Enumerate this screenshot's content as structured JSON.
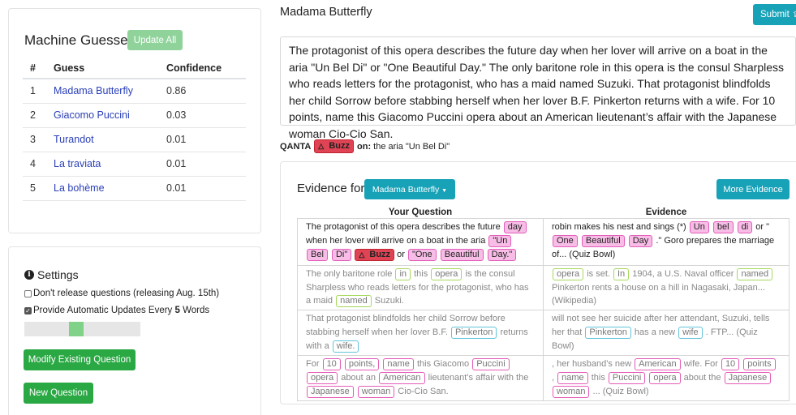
{
  "guesses": {
    "title": "Machine Guesses",
    "update_label": "Update All",
    "headers": [
      "#",
      "Guess",
      "Confidence"
    ],
    "rows": [
      {
        "num": "1",
        "guess": "Madama Butterfly",
        "conf": "0.86"
      },
      {
        "num": "2",
        "guess": "Giacomo Puccini",
        "conf": "0.03"
      },
      {
        "num": "3",
        "guess": "Turandot",
        "conf": "0.01"
      },
      {
        "num": "4",
        "guess": "La traviata",
        "conf": "0.01"
      },
      {
        "num": "5",
        "guess": "La bohème",
        "conf": "0.01"
      }
    ]
  },
  "settings": {
    "title": "Settings",
    "release_label": "Don't release questions (releasing Aug. 15th)",
    "release_checked": false,
    "updates_prefix": "Provide Automatic Updates Every ",
    "updates_count": "5",
    "updates_suffix": " Words",
    "updates_checked": true,
    "slider_fraction": 0.44,
    "modify_label": "Modify Existing Question",
    "new_label": "New Question"
  },
  "question": {
    "answer": "Madama Butterfly",
    "submit_label": "Submit",
    "text": "The protagonist of this opera describes the future day when her lover will arrive on a boat in the aria \"Un Bel Di\" or \"One Beautiful Day.\" The only baritone role in this opera is the consul Sharpless who reads letters for the protagonist, who has a maid named Suzuki. That protagonist blindfolds her child Sorrow before stabbing herself when her lover B.F. Pinkerton returns with a wife. For 10 points, name this Giacomo Puccini opera about an American lieutenant’s affair with the Japanese woman Cio-Cio San."
  },
  "buzz": {
    "prefix": "QANTA",
    "tag": "Buzz",
    "on_label": "on:",
    "text": "the aria \"Un Bel Di\""
  },
  "evidence": {
    "title": "Evidence for",
    "dropdown_label": "Madama Butterfly",
    "more_label": "More Evidence",
    "col_question": "Your Question",
    "col_evidence": "Evidence",
    "rows": [
      {
        "q": [
          {
            "t": "The protagonist of this opera describes the future "
          },
          {
            "t": "day",
            "h": "pink"
          },
          {
            "t": " when her lover will arrive on a boat in the aria "
          },
          {
            "t": "\"Un",
            "h": "pink"
          },
          {
            "t": " "
          },
          {
            "t": "Bel",
            "h": "pink"
          },
          {
            "t": " "
          },
          {
            "t": "Di\"",
            "h": "pink"
          },
          {
            "t": " "
          },
          {
            "t": "Buzz",
            "h": "buzz"
          },
          {
            "t": " or "
          },
          {
            "t": "\"One",
            "h": "pink"
          },
          {
            "t": " "
          },
          {
            "t": "Beautiful",
            "h": "pink"
          },
          {
            "t": " "
          },
          {
            "t": "Day.\"",
            "h": "pink"
          }
        ],
        "e": [
          {
            "t": "robin makes his nest and sings (*) "
          },
          {
            "t": "Un",
            "h": "pink"
          },
          {
            "t": " "
          },
          {
            "t": "bel",
            "h": "pink"
          },
          {
            "t": " "
          },
          {
            "t": "di",
            "h": "pink"
          },
          {
            "t": " or \" "
          },
          {
            "t": "One",
            "h": "pink"
          },
          {
            "t": " "
          },
          {
            "t": "Beautiful",
            "h": "pink"
          },
          {
            "t": " "
          },
          {
            "t": "Day",
            "h": "pink"
          },
          {
            "t": " .\" Goro prepares the marriage of... (Quiz Bowl)"
          }
        ]
      },
      {
        "q": [
          {
            "t": "The only baritone role "
          },
          {
            "t": "in",
            "h": "green"
          },
          {
            "t": " this "
          },
          {
            "t": "opera",
            "h": "green"
          },
          {
            "t": " is the consul Sharpless who reads letters for the protagonist, who has a maid "
          },
          {
            "t": "named",
            "h": "green"
          },
          {
            "t": " Suzuki."
          }
        ],
        "e": [
          {
            "t": "opera",
            "h": "green"
          },
          {
            "t": " is set. "
          },
          {
            "t": "In",
            "h": "green"
          },
          {
            "t": " 1904, a U.S. Naval officer "
          },
          {
            "t": "named",
            "h": "green"
          },
          {
            "t": " Pinkerton rents a house on a hill in Nagasaki, Japan... (Wikipedia)"
          }
        ]
      },
      {
        "q": [
          {
            "t": "That protagonist blindfolds her child Sorrow before stabbing herself when her lover B.F. "
          },
          {
            "t": "Pinkerton",
            "h": "blue"
          },
          {
            "t": " returns with a "
          },
          {
            "t": "wife.",
            "h": "blue"
          }
        ],
        "e": [
          {
            "t": "will not see her suicide after her attendant, Suzuki, tells her that "
          },
          {
            "t": "Pinkerton",
            "h": "blue"
          },
          {
            "t": " has a new "
          },
          {
            "t": "wife",
            "h": "blue"
          },
          {
            "t": " . FTP... (Quiz Bowl)"
          }
        ]
      },
      {
        "q": [
          {
            "t": "For "
          },
          {
            "t": "10",
            "h": "pinkout"
          },
          {
            "t": " "
          },
          {
            "t": "points,",
            "h": "pinkout"
          },
          {
            "t": " "
          },
          {
            "t": "name",
            "h": "pinkout"
          },
          {
            "t": " this Giacomo "
          },
          {
            "t": "Puccini",
            "h": "pinkout"
          },
          {
            "t": " "
          },
          {
            "t": "opera",
            "h": "pinkout"
          },
          {
            "t": " about an "
          },
          {
            "t": "American",
            "h": "pinkout"
          },
          {
            "t": " lieutenant’s affair with the "
          },
          {
            "t": "Japanese",
            "h": "pinkout"
          },
          {
            "t": " "
          },
          {
            "t": "woman",
            "h": "pinkout"
          },
          {
            "t": " Cio-Cio San."
          }
        ],
        "e": [
          {
            "t": ", her husband's new "
          },
          {
            "t": "American",
            "h": "pinkout"
          },
          {
            "t": " wife. For "
          },
          {
            "t": "10",
            "h": "pinkout"
          },
          {
            "t": " "
          },
          {
            "t": "points",
            "h": "pinkout"
          },
          {
            "t": " , "
          },
          {
            "t": "name",
            "h": "pinkout"
          },
          {
            "t": " this "
          },
          {
            "t": "Puccini",
            "h": "pinkout"
          },
          {
            "t": " "
          },
          {
            "t": "opera",
            "h": "pinkout"
          },
          {
            "t": " about the "
          },
          {
            "t": "Japanese",
            "h": "pinkout"
          },
          {
            "t": " "
          },
          {
            "t": "woman",
            "h": "pinkout"
          },
          {
            "t": " ... (Quiz Bowl)"
          }
        ]
      }
    ]
  }
}
